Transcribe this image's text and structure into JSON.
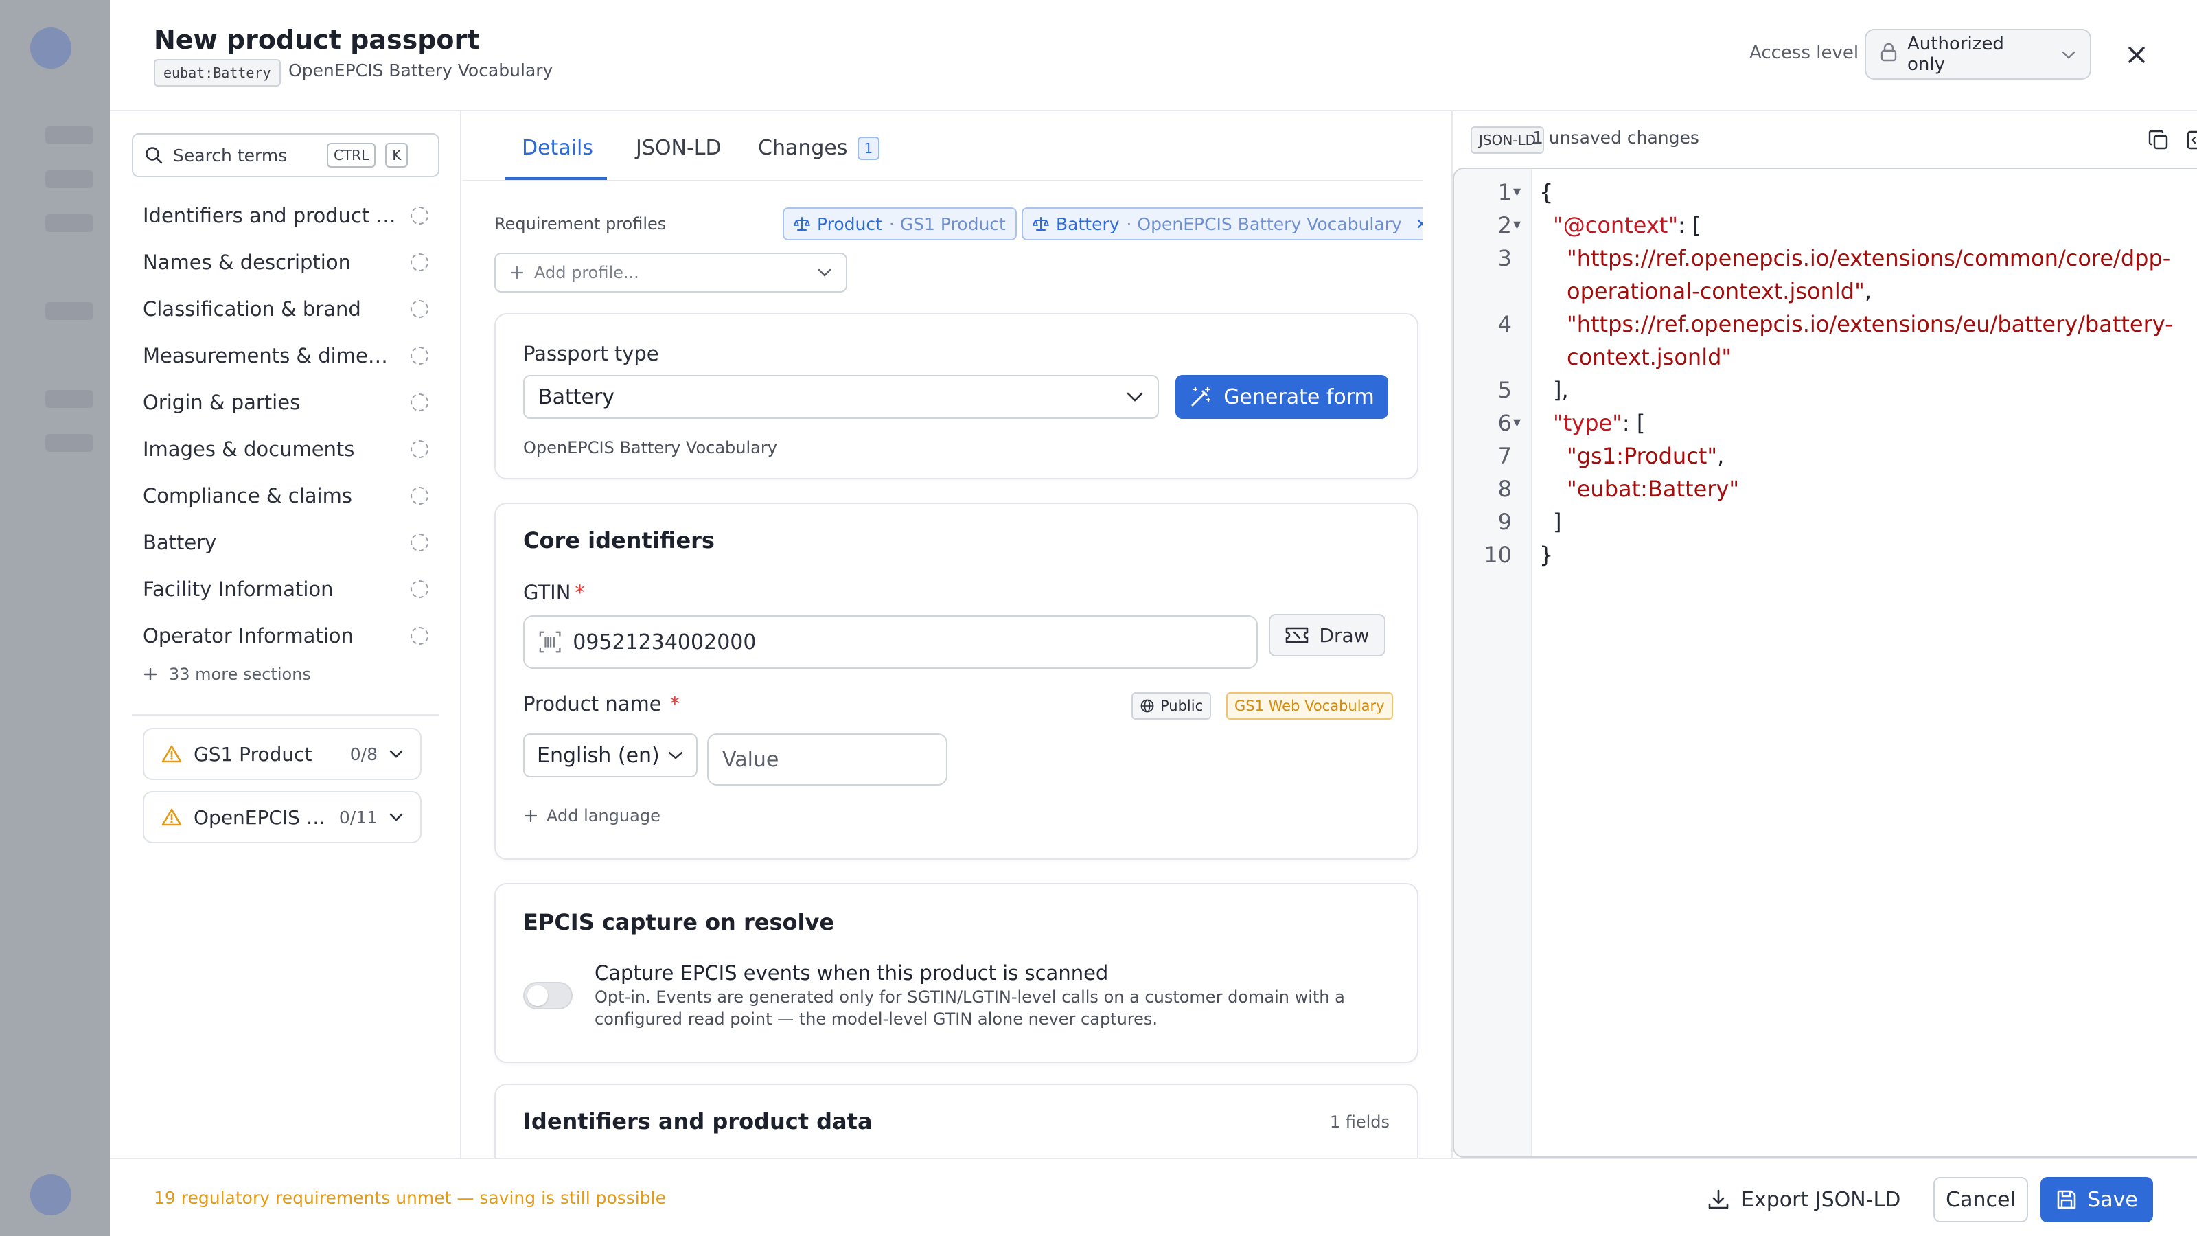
{
  "header": {
    "title": "New product passport",
    "code_chip": "eubat:Battery",
    "vocabulary": "OpenEPCIS Battery Vocabulary",
    "access_label": "Access level",
    "access_value": "Authorized only"
  },
  "sidebar": {
    "search_placeholder": "Search terms",
    "kbd_ctrl": "CTRL",
    "kbd_k": "K",
    "items": [
      {
        "label": "Identifiers and product data"
      },
      {
        "label": "Names & description"
      },
      {
        "label": "Classification & brand"
      },
      {
        "label": "Measurements & dimensions"
      },
      {
        "label": "Origin & parties"
      },
      {
        "label": "Images & documents"
      },
      {
        "label": "Compliance & claims"
      },
      {
        "label": "Battery"
      },
      {
        "label": "Facility Information"
      },
      {
        "label": "Operator Information"
      }
    ],
    "more_sections": "33 more sections",
    "profiles": [
      {
        "name": "GS1 Product",
        "count": "0/8"
      },
      {
        "name": "OpenEPCIS Battery Vocabulary",
        "count": "0/11"
      }
    ]
  },
  "tabs": [
    {
      "label": "Details"
    },
    {
      "label": "JSON-LD"
    },
    {
      "label": "Changes",
      "badge": "1"
    }
  ],
  "requirements": {
    "label": "Requirement profiles",
    "chips": [
      {
        "name": "Product",
        "sub": "· GS1 Product"
      },
      {
        "name": "Battery",
        "sub": "· OpenEPCIS Battery Vocabulary"
      }
    ],
    "add_profile": "Add profile..."
  },
  "passport_card": {
    "label": "Passport type",
    "value": "Battery",
    "generate_label": "Generate form",
    "hint": "OpenEPCIS Battery Vocabulary"
  },
  "core_card": {
    "title": "Core identifiers",
    "gtin_label": "GTIN",
    "gtin_value": "09521234002000",
    "draw_label": "Draw",
    "product_name_label": "Product name",
    "public_tag": "Public",
    "vocab_tag": "GS1 Web Vocabulary",
    "language_value": "English (en)",
    "value_placeholder": "Value",
    "add_language": "Add language"
  },
  "epcis_card": {
    "title": "EPCIS capture on resolve",
    "toggle_title": "Capture EPCIS events when this product is scanned",
    "toggle_desc": "Opt-in. Events are generated only for SGTIN/LGTIN-level calls on a customer domain with a configured read point — the model-level GTIN alone never captures.",
    "enabled": false
  },
  "identifiers_card": {
    "title": "Identifiers and product data",
    "count": "1 fields"
  },
  "json_panel": {
    "chip": "JSON-LD",
    "status": "1 unsaved changes",
    "lines": [
      {
        "n": "1",
        "fold": "▾",
        "t": "{"
      },
      {
        "n": "2",
        "fold": "▾",
        "k": "\"@context\"",
        "t": ": ["
      },
      {
        "n": "3",
        "s": "\"https://ref.openepcis.io/extensions/common/core/dpp-operational-context.jsonld\"",
        "t": ","
      },
      {
        "n": "4",
        "s": "\"https://ref.openepcis.io/extensions/eu/battery/battery-context.jsonld\""
      },
      {
        "n": "5",
        "t": "],"
      },
      {
        "n": "6",
        "fold": "▾",
        "k": "\"type\"",
        "t": ": ["
      },
      {
        "n": "7",
        "s": "\"gs1:Product\"",
        "t": ","
      },
      {
        "n": "8",
        "s": "\"eubat:Battery\""
      },
      {
        "n": "9",
        "t": "]"
      },
      {
        "n": "10",
        "t": "}"
      }
    ]
  },
  "footer": {
    "warning": "19 regulatory requirements unmet — saving is still possible",
    "export_label": "Export JSON-LD",
    "cancel_label": "Cancel",
    "save_label": "Save"
  },
  "colors": {
    "accent": "#2f6bd8",
    "warning": "#e39a14",
    "json_key": "#c7141d"
  }
}
